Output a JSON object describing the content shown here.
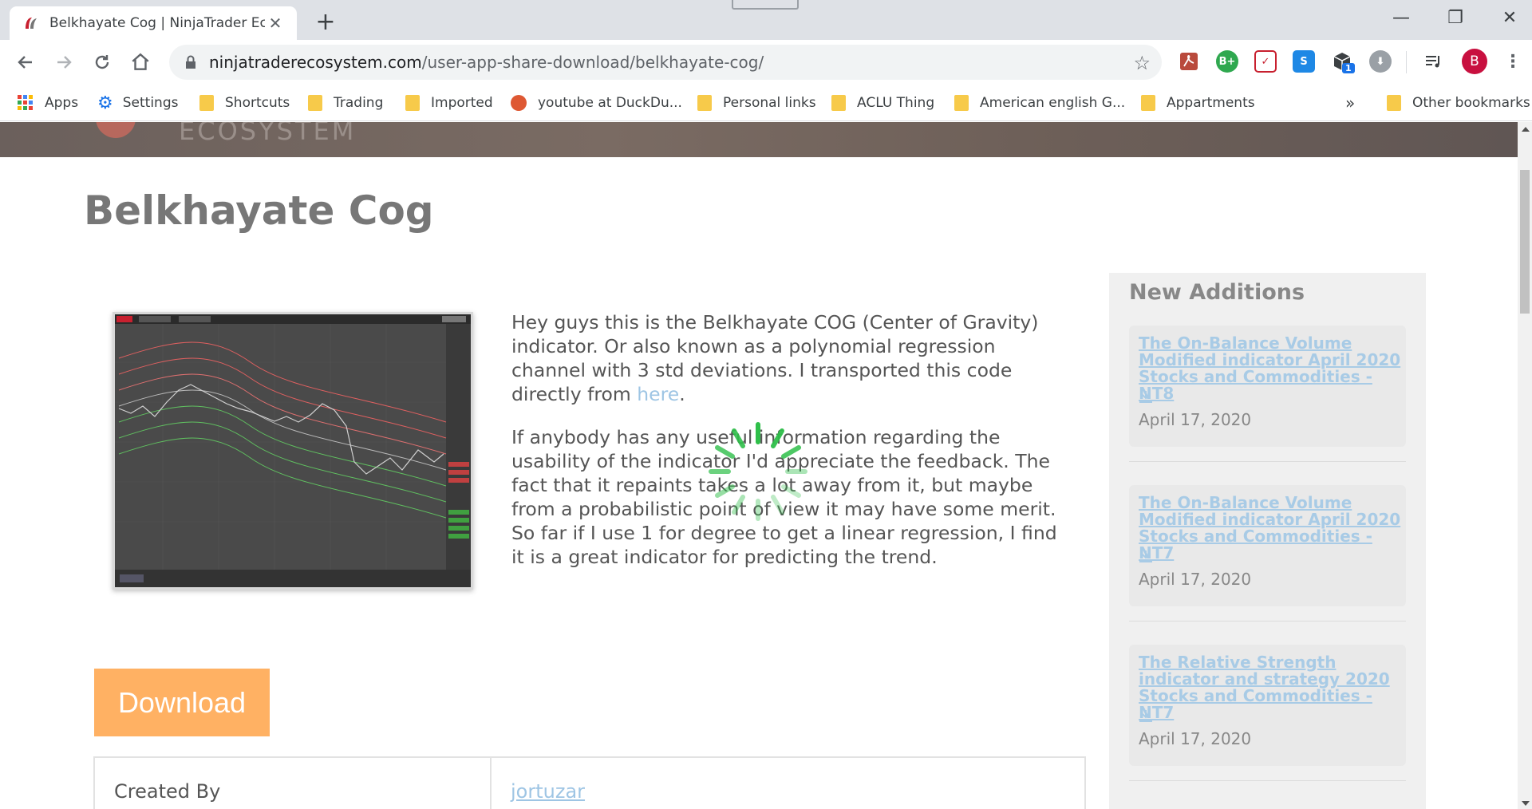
{
  "browser": {
    "tab_title": "Belkhayate Cog | NinjaTrader Eco",
    "url_host": "ninjatraderecosystem.com",
    "url_path": "/user-app-share-download/belkhayate-cog/",
    "profile_initial": "B",
    "ext_badge": "1",
    "bookmarks": [
      {
        "label": "Apps"
      },
      {
        "label": "Settings"
      },
      {
        "label": "Shortcuts"
      },
      {
        "label": "Trading"
      },
      {
        "label": "Imported"
      },
      {
        "label": "youtube at DuckDu..."
      },
      {
        "label": "Personal links"
      },
      {
        "label": "ACLU Thing"
      },
      {
        "label": "American english G..."
      },
      {
        "label": "Appartments"
      },
      {
        "label": "Other bookmarks"
      }
    ]
  },
  "header": {
    "logo_text": "ECOSYSTEM"
  },
  "page": {
    "title": "Belkhayate Cog",
    "description_p1": "Hey guys this is the Belkhayate COG (Center of Gravity) indicator. Or also known as a polynomial regression channel with 3 std deviations. I transported this code directly from ",
    "description_link": "here",
    "description_p1_end": ".",
    "description_p2": "If anybody has any useful information regarding the usability of the indicator I'd appreciate the feedback. The fact that it repaints takes a lot away from it, but maybe from a probabilistic point of view it may have some merit. So far if I use 1 for degree to get a linear regression, I find it is a great indicator for predicting the trend.",
    "download_label": "Download",
    "created_by_label": "Created By",
    "created_by_value": "jortuzar"
  },
  "sidebar": {
    "title": "New Additions",
    "items": [
      {
        "title": "The On-Balance Volume Modified indicator April 2020 Stocks and Commodities - NT8",
        "date": "April 17, 2020"
      },
      {
        "title": "The On-Balance Volume Modified indicator April 2020 Stocks and Commodities - NT7",
        "date": "April 17, 2020"
      },
      {
        "title": "The Relative Strength indicator and strategy 2020 Stocks and Commodities - NT7",
        "date": "April 17, 2020"
      }
    ]
  },
  "colors": {
    "download": "#ffb163",
    "link": "#9ec5e4",
    "spinner": "#2fbf4a"
  }
}
